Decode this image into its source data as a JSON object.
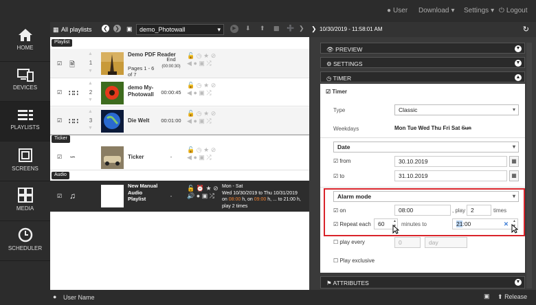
{
  "topbar": {
    "user": "User",
    "download": "Download",
    "settings": "Settings",
    "logout": "Logout"
  },
  "sidebar": [
    {
      "label": "HOME",
      "icon": "home-icon"
    },
    {
      "label": "DEVICES",
      "icon": "devices-icon"
    },
    {
      "label": "PLAYLISTS",
      "icon": "playlists-icon",
      "active": true
    },
    {
      "label": "SCREENS",
      "icon": "screens-icon"
    },
    {
      "label": "MEDIA",
      "icon": "media-icon"
    },
    {
      "label": "SCHEDULER",
      "icon": "scheduler-icon"
    }
  ],
  "playlist_header": {
    "title": "All playlists",
    "current": "demo_Photowall"
  },
  "sections": {
    "playlist": "Playlist",
    "ticker": "Ticker",
    "audio": "Audio"
  },
  "rows": [
    {
      "num": "1",
      "name": "Demo PDF Reader",
      "sub": "Pages 1 - 6 of 7",
      "dur": "End",
      "dur2": "(00:00:30)"
    },
    {
      "num": "2",
      "name": "demo My-Photowall",
      "dur": "00:00:45"
    },
    {
      "num": "3",
      "name": "Die Welt",
      "dur": "00:01:00"
    },
    {
      "name": "Ticker",
      "dur": "-"
    },
    {
      "name": "New Manual Audio Playlist",
      "dur": "-",
      "sched1": "Mon - Sat",
      "sched2": "Wed 10/30/2019 to Thu 10/31/2019",
      "sched3a": "on ",
      "sched3b": "08:00",
      "sched3c": " h, on ",
      "sched3d": "09:00",
      "sched3e": " h, ... to 21:00 h,",
      "sched4": "play 2 times"
    }
  ],
  "right_header": {
    "datetime": "10/30/2019 - 11:58:01 AM"
  },
  "accordion": {
    "preview": "PREVIEW",
    "settings": "SETTINGS",
    "timer": "TIMER",
    "attributes": "ATTRIBUTES"
  },
  "timer": {
    "enabled_label": "Timer",
    "type_label": "Type",
    "type_value": "Classic",
    "weekdays_label": "Weekdays",
    "weekdays": [
      "Mon",
      "Tue",
      "Wed",
      "Thu",
      "Fri",
      "Sat",
      "Sun"
    ],
    "date_select": "Date",
    "from_label": "from",
    "from_value": "30.10.2019",
    "to_label": "to",
    "to_value": "31.10.2019",
    "alarm_select": "Alarm mode",
    "on_label": "on",
    "on_value": "08:00",
    "play_label": ", play",
    "play_value": "2",
    "times_label": "times",
    "repeat_label": "Repeat each",
    "repeat_value": "60",
    "minutes_to_label": "minutes to",
    "to_time_hour": "21",
    "to_time_rest": ":00",
    "play_every_label": "play every",
    "play_every_value": "0",
    "day_placeholder": "day",
    "exclusive_label": "Play exclusive"
  },
  "bottombar": {
    "username": "User Name",
    "release": "Release"
  }
}
